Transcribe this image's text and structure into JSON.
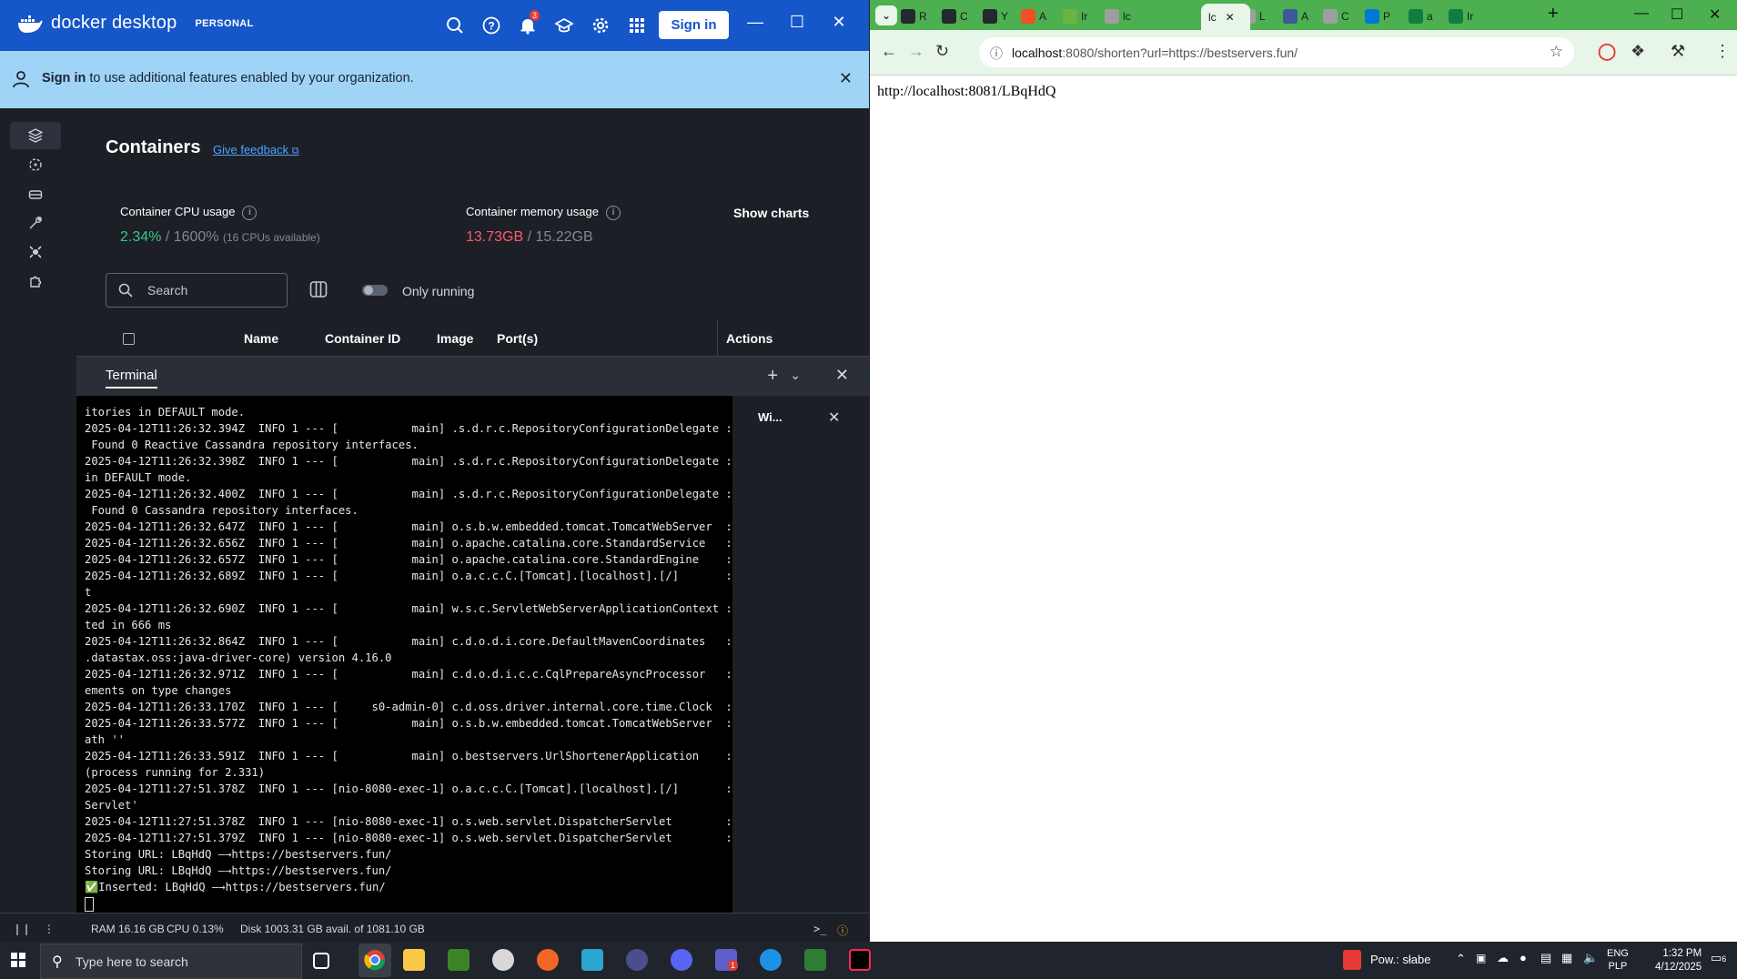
{
  "docker": {
    "brand": "docker desktop",
    "plan": "PERSONAL",
    "notification_count": "3",
    "signin_label": "Sign in",
    "banner": {
      "bold": "Sign in",
      "text": " to use additional features enabled by your organization."
    },
    "page_title": "Containers",
    "feedback_label": "Give feedback",
    "cpu": {
      "label": "Container CPU usage",
      "value": "2.34%",
      "total": "/ 1600%",
      "note": "(16 CPUs available)"
    },
    "memory": {
      "label": "Container memory usage",
      "value": "13.73GB",
      "total": "/ 15.22GB"
    },
    "show_charts_label": "Show charts",
    "search_placeholder": "Search",
    "only_running_label": "Only running",
    "columns": [
      "Name",
      "Container ID",
      "Image",
      "Port(s)",
      "Actions"
    ],
    "terminal": {
      "tab_label": "Terminal",
      "side_title": "Wi...",
      "lines": [
        "itories in DEFAULT mode.",
        "2025-04-12T11:26:32.394Z  INFO 1 --- [           main] .s.d.r.c.RepositoryConfigurationDelegate : Fini",
        " Found 0 Reactive Cassandra repository interfaces.",
        "2025-04-12T11:26:32.398Z  INFO 1 --- [           main] .s.d.r.c.RepositoryConfigurationDelegate : Boot",
        "in DEFAULT mode.",
        "2025-04-12T11:26:32.400Z  INFO 1 --- [           main] .s.d.r.c.RepositoryConfigurationDelegate : Fini",
        " Found 0 Cassandra repository interfaces.",
        "2025-04-12T11:26:32.647Z  INFO 1 --- [           main] o.s.b.w.embedded.tomcat.TomcatWebServer  : Tomc",
        "2025-04-12T11:26:32.656Z  INFO 1 --- [           main] o.apache.catalina.core.StandardService   : Star",
        "2025-04-12T11:26:32.657Z  INFO 1 --- [           main] o.apache.catalina.core.StandardEngine    : Star",
        "2025-04-12T11:26:32.689Z  INFO 1 --- [           main] o.a.c.c.C.[Tomcat].[localhost].[/]       : Init",
        "t",
        "2025-04-12T11:26:32.690Z  INFO 1 --- [           main] w.s.c.ServletWebServerApplicationContext : Root",
        "ted in 666 ms",
        "2025-04-12T11:26:32.864Z  INFO 1 --- [           main] c.d.o.d.i.core.DefaultMavenCoordinates   : Data",
        ".datastax.oss:java-driver-core) version 4.16.0",
        "2025-04-12T11:26:32.971Z  INFO 1 --- [           main] c.d.o.d.i.c.c.CqlPrepareAsyncProcessor   : Addi",
        "ements on type changes",
        "2025-04-12T11:26:33.170Z  INFO 1 --- [     s0-admin-0] c.d.oss.driver.internal.core.time.Clock  : Usin",
        "2025-04-12T11:26:33.577Z  INFO 1 --- [           main] o.s.b.w.embedded.tomcat.TomcatWebServer  : Tomc",
        "ath ''",
        "2025-04-12T11:26:33.591Z  INFO 1 --- [           main] o.bestservers.UrlShortenerApplication    : Star",
        "(process running for 2.331)",
        "2025-04-12T11:27:51.378Z  INFO 1 --- [nio-8080-exec-1] o.a.c.c.C.[Tomcat].[localhost].[/]       : Init",
        "Servlet'",
        "2025-04-12T11:27:51.378Z  INFO 1 --- [nio-8080-exec-1] o.s.web.servlet.DispatcherServlet        : Init",
        "2025-04-12T11:27:51.379Z  INFO 1 --- [nio-8080-exec-1] o.s.web.servlet.DispatcherServlet        : Comp",
        "Storing URL: LBqHdQ —→https://bestservers.fun/",
        "Storing URL: LBqHdQ —→https://bestservers.fun/",
        "✅Inserted: LBqHdQ —→https://bestservers.fun/"
      ]
    },
    "status": {
      "ram": "RAM 16.16 GB",
      "cpu": "CPU 0.13%",
      "disk": "Disk 1003.31 GB avail. of 1081.10 GB"
    }
  },
  "chrome": {
    "tabs": [
      {
        "label": "R",
        "color": "#24292f"
      },
      {
        "label": "C",
        "color": "#24292f"
      },
      {
        "label": "Y",
        "color": "#24292f"
      },
      {
        "label": "A",
        "color": "#f25022"
      },
      {
        "label": "Ir",
        "color": "#6db33f"
      },
      {
        "label": "lc",
        "color": "#9e9e9e"
      },
      {
        "label": "L",
        "color": "#9e9e9e"
      },
      {
        "label": "A",
        "color": "#3b5998"
      },
      {
        "label": "C",
        "color": "#9e9e9e"
      },
      {
        "label": "P",
        "color": "#0078d4"
      },
      {
        "label": "a",
        "color": "#107c41"
      },
      {
        "label": "Ir",
        "color": "#107c41"
      }
    ],
    "active_tab_label": "lc",
    "url_host": "localhost",
    "url_rest": ":8080/shorten?url=https://bestservers.fun/",
    "page_text": "http://localhost:8081/LBqHdQ"
  },
  "taskbar": {
    "search_placeholder": "Type here to search",
    "weather": "Pow.: słabe",
    "lang_top": "ENG",
    "lang_bottom": "PLP",
    "time": "1:32 PM",
    "date": "4/12/2025",
    "notification_count": "6",
    "teams_badge": "1"
  }
}
